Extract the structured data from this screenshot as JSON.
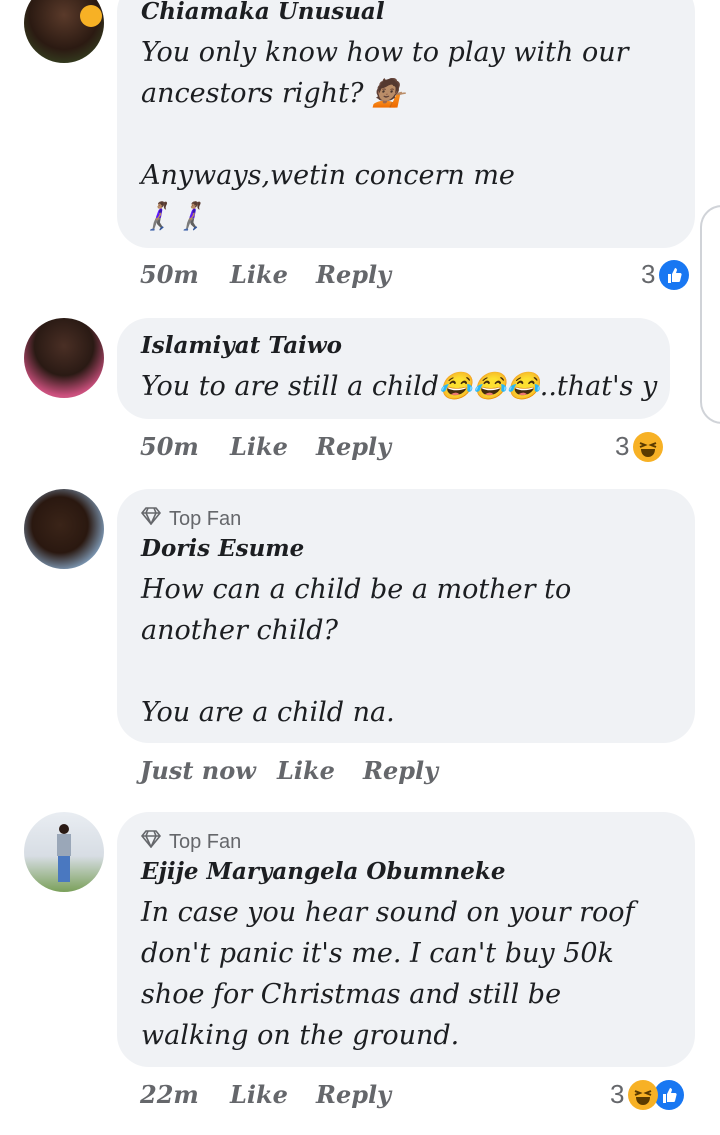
{
  "comments": [
    {
      "author": "Chiamaka Unusual",
      "top_fan": false,
      "text": "You only know how to play with our ancestors right? 💁🏽\n\nAnyways,wetin concern me\n🚶🏽‍♀️🚶🏽‍♀️",
      "time": "50m",
      "like": "Like",
      "reply": "Reply",
      "reaction_count": "3",
      "reactions": [
        "like-icon"
      ]
    },
    {
      "author": "Islamiyat Taiwo",
      "top_fan": false,
      "text": "You to are still a child😂😂😂..that's y",
      "time": "50m",
      "like": "Like",
      "reply": "Reply",
      "reaction_count": "3",
      "reactions": [
        "haha-icon"
      ]
    },
    {
      "author": "Doris Esume",
      "top_fan": true,
      "badge": "Top Fan",
      "text": "How can a child be a mother to another child?\n\nYou are a child na.",
      "time": "Just now",
      "like": "Like",
      "reply": "Reply"
    },
    {
      "author": "Ejije Maryangela Obumneke",
      "top_fan": true,
      "badge": "Top Fan",
      "text": "In case you hear sound on your roof don't panic it's me. I can't buy 50k shoe for Christmas and still be walking on the ground.",
      "time": "22m",
      "like": "Like",
      "reply": "Reply",
      "reaction_count": "3",
      "reactions": [
        "haha-icon",
        "like-icon"
      ]
    }
  ],
  "colors": {
    "bubble": "#f0f2f5",
    "like_blue": "#1877f2",
    "haha_yellow": "#f7b125",
    "meta_gray": "#65676b"
  }
}
